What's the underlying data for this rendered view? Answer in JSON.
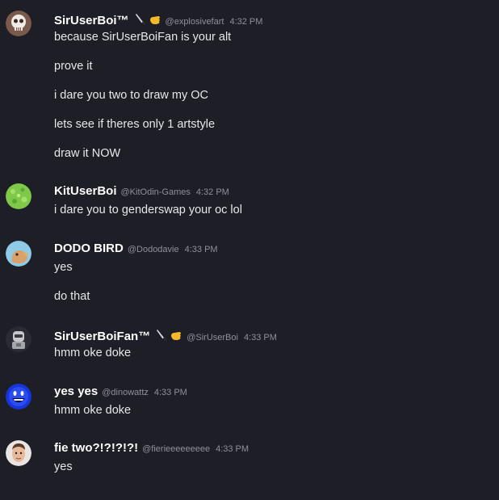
{
  "messages": [
    {
      "username": "SirUserBoi™",
      "handle": "@explosivefart",
      "time": "4:32 PM",
      "badges": [
        "knife-icon",
        "hand-icon"
      ],
      "lines": [
        "because SirUserBoiFan is your alt",
        "prove it",
        "i dare you two to draw my OC",
        "lets see if theres only 1 artstyle",
        "draw it NOW"
      ]
    },
    {
      "username": "KitUserBoi",
      "handle": "@KitOdin-Games",
      "time": "4:32 PM",
      "badges": [],
      "lines": [
        "i dare you to genderswap your oc lol"
      ]
    },
    {
      "username": "DODO BIRD",
      "handle": "@Dododavie",
      "time": "4:33 PM",
      "badges": [],
      "lines": [
        "yes",
        "do that"
      ]
    },
    {
      "username": "SirUserBoiFan™",
      "handle": "@SirUserBoi",
      "time": "4:33 PM",
      "badges": [
        "knife-icon",
        "hand-icon"
      ],
      "lines": [
        "hmm oke doke"
      ]
    },
    {
      "username": "yes yes",
      "handle": "@dinowattz",
      "time": "4:33 PM",
      "badges": [],
      "lines": [
        "hmm oke doke"
      ]
    },
    {
      "username": "fie two?!?!?!?!",
      "handle": "@fierieeeeeeeee",
      "time": "4:33 PM",
      "badges": [],
      "lines": [
        "yes"
      ]
    }
  ],
  "colors": {
    "background": "#1e1f26",
    "username": "#ffffff",
    "meta": "#8e909a",
    "text": "#e6e7ea"
  }
}
